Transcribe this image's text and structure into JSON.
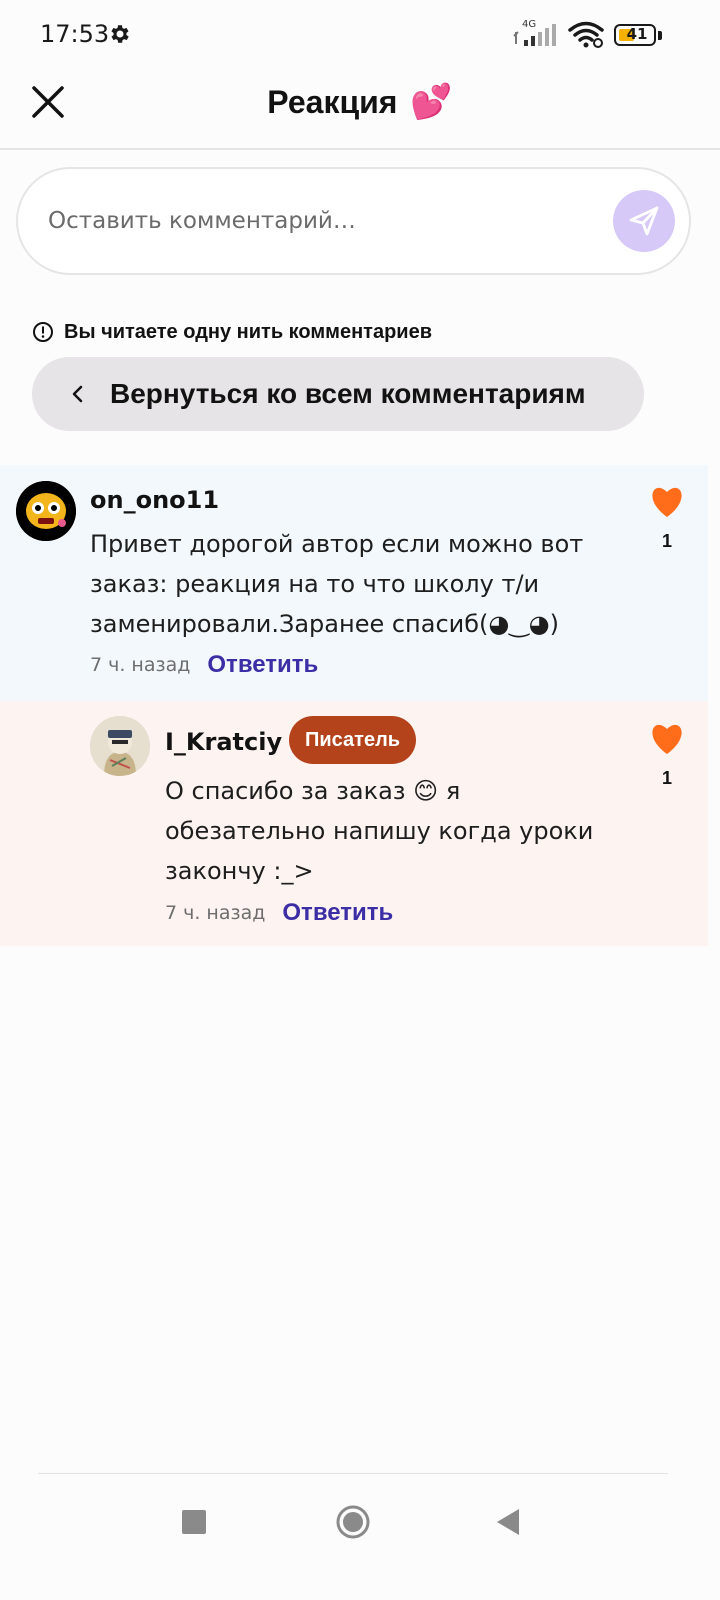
{
  "status_bar": {
    "time": "17:53",
    "network": "4G",
    "battery": "41"
  },
  "header": {
    "title": "Реакция",
    "title_emoji": "💕"
  },
  "comment_box": {
    "placeholder": "Оставить комментарий…"
  },
  "thread_notice": {
    "text": "Вы читаете одну нить комментариев"
  },
  "back_button": {
    "label": "Вернуться ко всем комментариям"
  },
  "comments": [
    {
      "username": "on_ono11",
      "text": "Привет дорогой автор если можно вот заказ: реакция на то что школу т/и заменировали.Заранее спасиб(◕‿◕)",
      "time": "7 ч. назад",
      "reply_label": "Ответить",
      "likes": "1"
    },
    {
      "username": "I_Kratciy",
      "badge": "Писатель",
      "text": "О спасибо за заказ 😊 я обезательно напишу когда уроки закончу :_>",
      "time": "7 ч. назад",
      "reply_label": "Ответить",
      "likes": "1"
    }
  ],
  "colors": {
    "accent_like": "#ff6c1a",
    "reply_link": "#3c2fa6",
    "writer_badge": "#b4431b",
    "send_button": "#d6c8f7",
    "comment_bg_1": "#f2f8fc",
    "comment_bg_2": "#fdf3f1"
  },
  "icons": {
    "close": "close-icon",
    "send": "send-icon",
    "info": "info-icon",
    "back": "chevron-left-icon",
    "like": "heart-icon",
    "settings": "gear-icon"
  }
}
